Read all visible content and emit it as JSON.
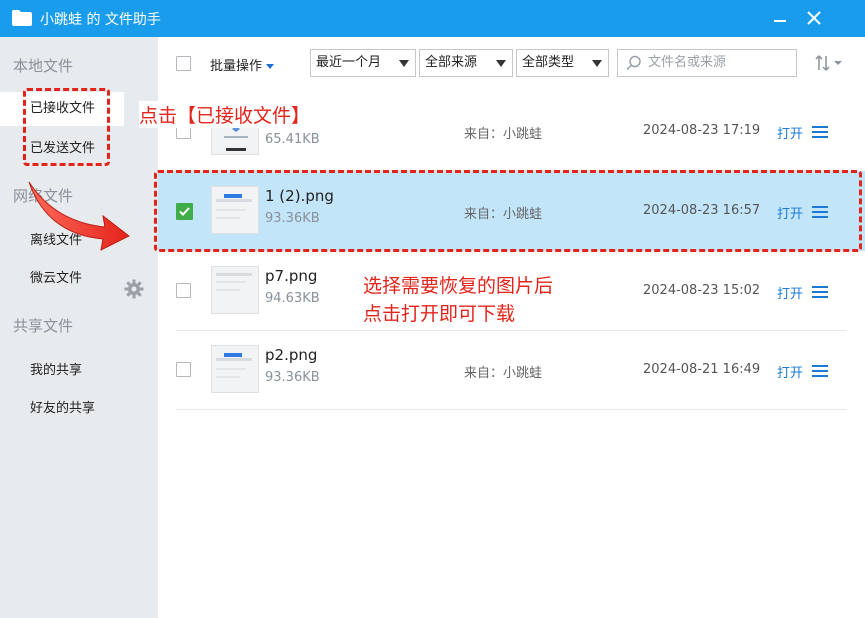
{
  "window": {
    "title": "小跳蛙 的 文件助手"
  },
  "sidebar": {
    "local_header": "本地文件",
    "local_items": [
      "已接收文件",
      "已发送文件"
    ],
    "network_header": "网络文件",
    "network_items": [
      "离线文件",
      "微云文件"
    ],
    "shared_header": "共享文件",
    "shared_items": [
      "我的共享",
      "好友的共享"
    ]
  },
  "toolbar": {
    "batch_label": "批量操作",
    "time_filter": "最近一个月",
    "source_filter": "全部来源",
    "type_filter": "全部类型",
    "search_placeholder": "文件名或来源"
  },
  "files": [
    {
      "name": "",
      "size": "65.41KB",
      "from": "来自：小跳蛙",
      "date": "2024-08-23 17:19",
      "open": "打开",
      "checked": false
    },
    {
      "name": "1 (2).png",
      "size": "93.36KB",
      "from": "来自：小跳蛙",
      "date": "2024-08-23 16:57",
      "open": "打开",
      "checked": true
    },
    {
      "name": "p7.png",
      "size": "94.63KB",
      "from": "",
      "date": "2024-08-23 15:02",
      "open": "打开",
      "checked": false
    },
    {
      "name": "p2.png",
      "size": "93.36KB",
      "from": "来自：小跳蛙",
      "date": "2024-08-21 16:49",
      "open": "打开",
      "checked": false
    }
  ],
  "annotations": {
    "click_received": "点击【已接收文件】",
    "step_line1": "选择需要恢复的图片后",
    "step_line2": "点击打开即可下载"
  },
  "colors": {
    "titlebar": "#1a9cec",
    "selected_row": "#c2e5fa",
    "annotation": "#e3241b",
    "link": "#1a7ad6"
  }
}
